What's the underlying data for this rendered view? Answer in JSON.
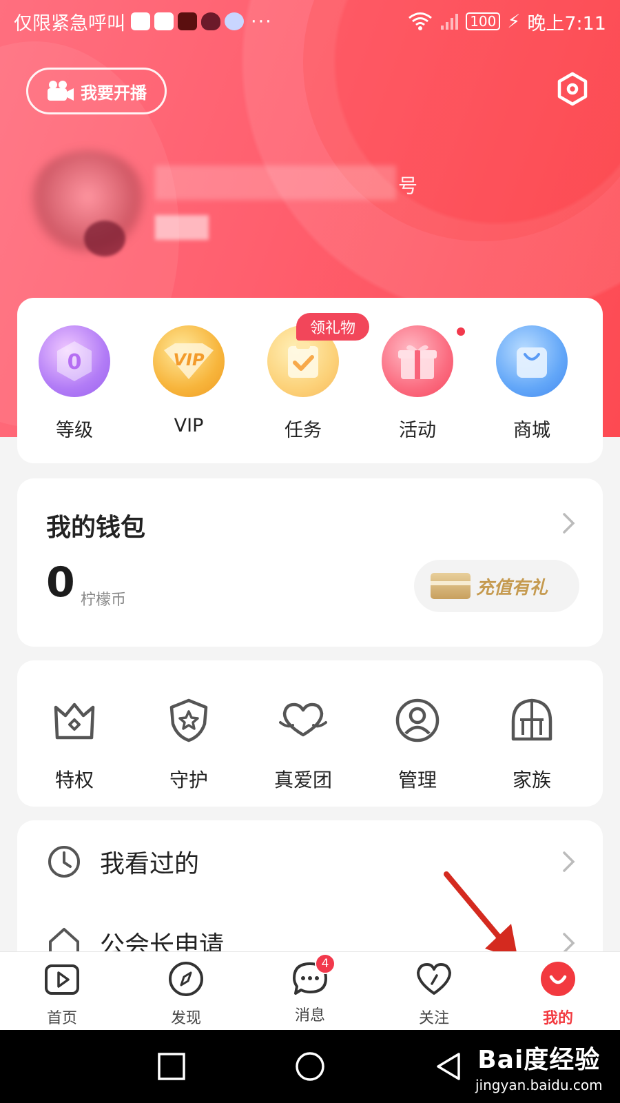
{
  "status_bar": {
    "carrier": "仅限紧急呼叫",
    "more": "···",
    "battery": "100",
    "time": "晚上7:11"
  },
  "header": {
    "live_button_label": "我要开播",
    "profile_suffix": "号"
  },
  "quick_actions": {
    "gift_badge": "领礼物",
    "level_value": "0",
    "vip_text": "VIP",
    "items": [
      {
        "label": "等级"
      },
      {
        "label": "VIP"
      },
      {
        "label": "任务"
      },
      {
        "label": "活动"
      },
      {
        "label": "商城"
      }
    ]
  },
  "wallet": {
    "title": "我的钱包",
    "amount": "0",
    "unit": "柠檬币",
    "recharge_label": "充值有礼"
  },
  "features": {
    "items": [
      {
        "label": "特权",
        "icon": "crown-icon"
      },
      {
        "label": "守护",
        "icon": "shield-star-icon"
      },
      {
        "label": "真爱团",
        "icon": "heart-icon"
      },
      {
        "label": "管理",
        "icon": "user-circle-icon"
      },
      {
        "label": "家族",
        "icon": "helmet-icon"
      }
    ]
  },
  "menu_list": {
    "items": [
      {
        "label": "我看过的",
        "icon": "clock-icon"
      },
      {
        "label": "公会长申请",
        "icon": "house-icon"
      }
    ]
  },
  "bottom_nav": {
    "active": "我的",
    "message_badge": "4",
    "tabs": [
      {
        "label": "首页",
        "icon": "play-icon"
      },
      {
        "label": "发现",
        "icon": "compass-icon"
      },
      {
        "label": "消息",
        "icon": "chat-icon"
      },
      {
        "label": "关注",
        "icon": "heart-icon"
      },
      {
        "label": "我的",
        "icon": "smile-icon"
      }
    ]
  },
  "watermark": {
    "brand": "Bai度经验",
    "url": "jingyan.baidu.com"
  },
  "colors": {
    "accent": "#f2393f",
    "header_start": "#ff6f7f",
    "header_end": "#fd4a52",
    "gold": "#c59a4f"
  }
}
